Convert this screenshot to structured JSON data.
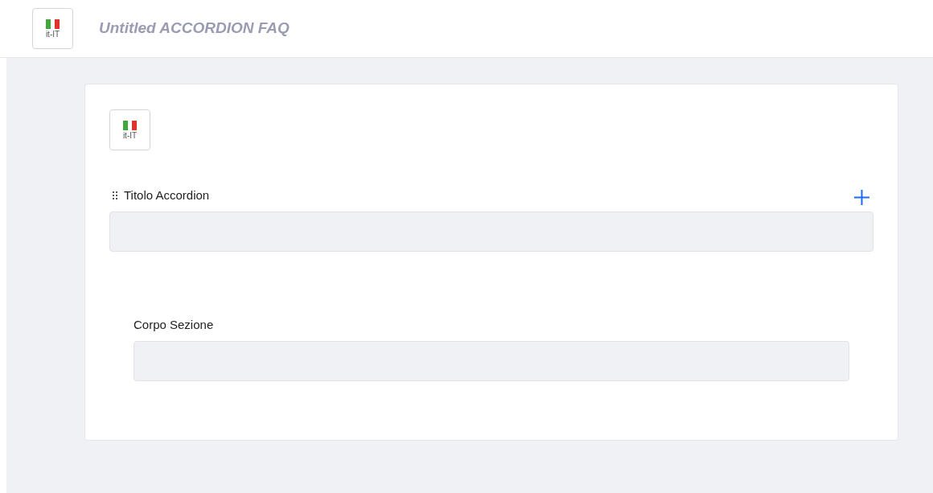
{
  "header": {
    "locale": "it-IT",
    "title": "Untitled ACCORDION FAQ"
  },
  "card": {
    "locale": "it-IT",
    "title_field": {
      "label": "Titolo Accordion"
    },
    "body_field": {
      "label": "Corpo Sezione"
    }
  }
}
